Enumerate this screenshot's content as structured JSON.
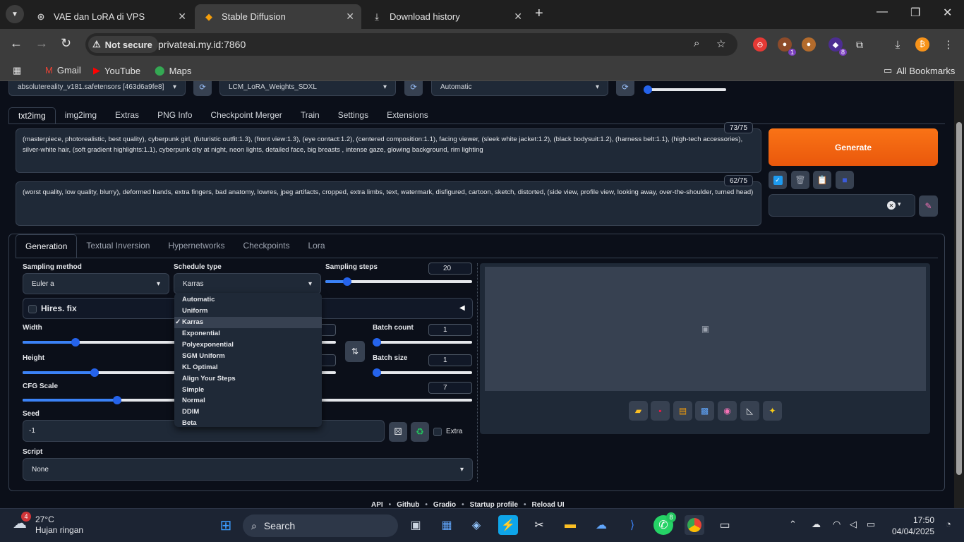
{
  "browser": {
    "tabs": [
      {
        "title": "VAE dan LoRA di VPS",
        "icon": "chatgpt-icon"
      },
      {
        "title": "Stable Diffusion",
        "icon": "gradio-icon"
      },
      {
        "title": "Download history",
        "icon": "download-icon"
      }
    ],
    "security_label": "Not secure",
    "url": "privateai.my.id:7860",
    "bookmarks": [
      "Gmail",
      "YouTube",
      "Maps"
    ],
    "all_bookmarks": "All Bookmarks",
    "extension_badges": [
      "1",
      "8"
    ]
  },
  "top_bar": {
    "checkpoint": "absolutereality_v181.safetensors [463d6a9fe8]",
    "lora": "LCM_LoRA_Weights_SDXL",
    "vae": "Automatic"
  },
  "main_tabs": [
    "txt2img",
    "img2img",
    "Extras",
    "PNG Info",
    "Checkpoint Merger",
    "Train",
    "Settings",
    "Extensions"
  ],
  "prompt": {
    "text": "(masterpiece, photorealistic, best quality), cyberpunk girl, (futuristic outfit:1.3), (front view:1.3), (eye contact:1.2), (centered composition:1.1), facing viewer,  (sleek white jacket:1.2), (black bodysuit:1.2), (harness belt:1.1), (high-tech accessories), silver-white hair, (soft gradient highlights:1.1), cyberpunk city at night, neon lights, detailed face, big breasts , intense gaze, glowing background, rim lighting",
    "counter": "73/75"
  },
  "negative_prompt": {
    "text": "(worst quality, low quality, blurry), deformed hands, extra fingers, bad anatomy, lowres, jpeg artifacts, cropped, extra limbs, text, watermark, disfigured, cartoon, sketch, distorted, (side view, profile view, looking away, over-the-shoulder, turned head)",
    "counter": "62/75"
  },
  "generate_label": "Generate",
  "sub_tabs": [
    "Generation",
    "Textual Inversion",
    "Hypernetworks",
    "Checkpoints",
    "Lora"
  ],
  "generation": {
    "sampling_method_label": "Sampling method",
    "sampling_method": "Euler a",
    "schedule_type_label": "Schedule type",
    "schedule_type": "Karras",
    "sampling_steps_label": "Sampling steps",
    "sampling_steps": "20",
    "sampling_steps_fraction": 0.15,
    "hires_label": "Hires. fix",
    "width_label": "Width",
    "width_fraction": 0.17,
    "height_label": "Height",
    "height_fraction": 0.23,
    "batch_count_label": "Batch count",
    "batch_count": "1",
    "batch_size_label": "Batch size",
    "batch_size": "1",
    "cfg_label": "CFG Scale",
    "cfg": "7",
    "cfg_fraction": 0.21,
    "seed_label": "Seed",
    "seed": "-1",
    "extra_label": "Extra",
    "script_label": "Script",
    "script": "None"
  },
  "schedule_options": [
    "Automatic",
    "Uniform",
    "Karras",
    "Exponential",
    "Polyexponential",
    "SGM Uniform",
    "KL Optimal",
    "Align Your Steps",
    "Simple",
    "Normal",
    "DDIM",
    "Beta"
  ],
  "schedule_check": "✓",
  "footer_links": [
    "API",
    "Github",
    "Gradio",
    "Startup profile",
    "Reload UI"
  ],
  "taskbar": {
    "weather_badge": "4",
    "temperature": "27°C",
    "condition": "Hujan ringan",
    "search_label": "Search",
    "whatsapp_badge": "8",
    "time": "17:50",
    "date": "04/04/2025"
  },
  "colors": {
    "accent": "#ea580c",
    "slider": "#3b82f6",
    "background": "#0b0f19"
  }
}
